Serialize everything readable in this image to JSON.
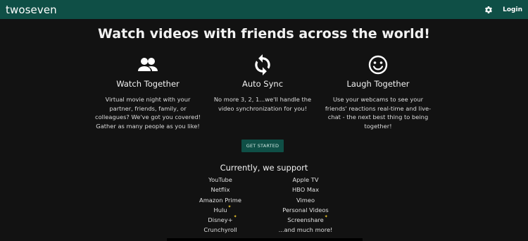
{
  "topbar": {
    "brand": "twoseven",
    "login_label": "Login",
    "settings_icon": "gear-icon"
  },
  "hero": {
    "headline": "Watch videos with friends across the world!"
  },
  "features": [
    {
      "icon": "people-icon",
      "title": "Watch Together",
      "lines": [
        "Virtual movie night with your",
        "partner, friends, family, or",
        "colleagues? We've got you covered!",
        "Gather as many people as you like!"
      ]
    },
    {
      "icon": "sync-icon",
      "title": "Auto Sync",
      "lines": [
        "No more 3, 2, 1...we'll handle the",
        "video synchronization for you!"
      ]
    },
    {
      "icon": "smiley-icon",
      "title": "Laugh Together",
      "lines": [
        "Use your webcams to see your",
        "friends' reactions real-time and live-",
        "chat - the next best thing to being",
        "together!"
      ]
    }
  ],
  "cta": {
    "label": "GET STARTED"
  },
  "support": {
    "title": "Currently, we support",
    "left": [
      "YouTube",
      "Netflix",
      "Amazon Prime",
      "Hulu",
      "Disney+",
      "Crunchyroll"
    ],
    "right": [
      "Apple TV",
      "HBO Max",
      "Vimeo",
      "Personal Videos",
      "Screenshare",
      "...and much more!"
    ]
  },
  "colors": {
    "accent": "#0f4f46",
    "background": "#121212",
    "sparkle": "#e6c229"
  }
}
